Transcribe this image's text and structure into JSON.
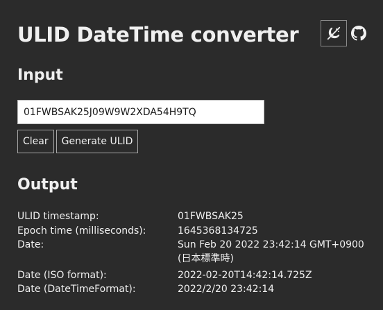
{
  "header": {
    "title": "ULID DateTime converter",
    "theme_icon": "color-scheme-toggle-icon",
    "github_icon": "github-icon"
  },
  "input_section": {
    "heading": "Input",
    "ulid_value": "01FWBSAK25J09W9W2XDA54H9TQ",
    "clear_label": "Clear",
    "generate_label": "Generate ULID"
  },
  "output_section": {
    "heading": "Output",
    "rows": [
      {
        "label": "ULID timestamp:",
        "value": "01FWBSAK25"
      },
      {
        "label": "Epoch time (milliseconds):",
        "value": "1645368134725"
      },
      {
        "label": "Date:",
        "value": "Sun Feb 20 2022 23:42:14 GMT+0900 (日本標準時)"
      },
      {
        "label": "Date (ISO format):",
        "value": "2022-02-20T14:42:14.725Z"
      },
      {
        "label": "Date (DateTimeFormat):",
        "value": "2022/2/20 23:42:14"
      }
    ]
  },
  "colors": {
    "background": "#2b2b2b",
    "text": "#f0f0f0",
    "input_background": "#ffffff"
  }
}
